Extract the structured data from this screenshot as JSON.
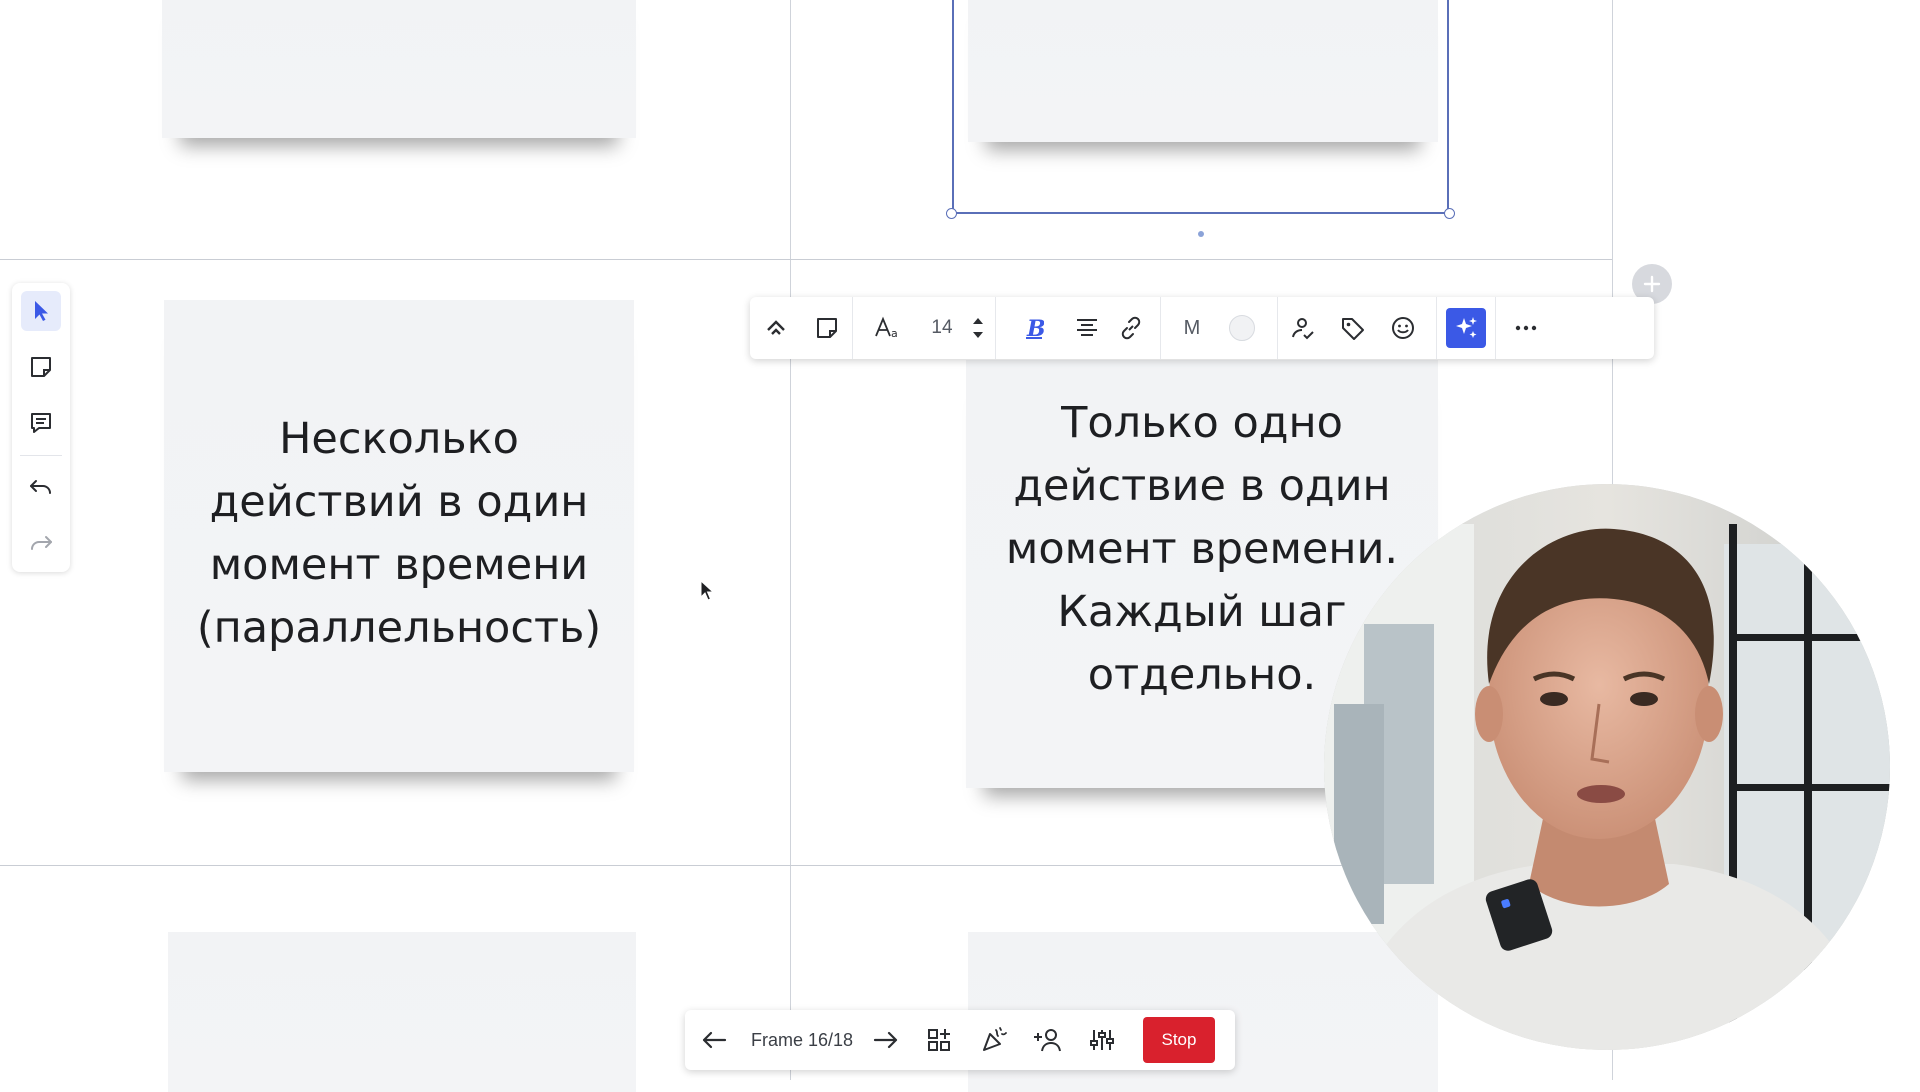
{
  "sticky_notes": {
    "left_text": "Несколько\nдействий в один\nмомент времени\n(параллельность)",
    "right_text": "Только одно\nдействие в один\nмомент времени.\nКаждый шаг\nотдельно."
  },
  "context_toolbar": {
    "font_size": "14",
    "font_size_letter": "M",
    "icons": [
      "convert-icon",
      "sticky-note-icon",
      "text-style-icon",
      "font-size-stepper",
      "bold-icon",
      "align-center-icon",
      "link-icon",
      "font-letter",
      "color-swatch",
      "assign-icon",
      "tag-icon",
      "emoji-icon",
      "ai-sparkle-icon",
      "more-icon"
    ]
  },
  "tool_rail": {
    "items": [
      "select-tool",
      "sticky-note-tool",
      "comment-tool",
      "undo",
      "redo"
    ]
  },
  "presentation_bar": {
    "frame_label": "Frame 16/18",
    "stop_label": "Stop"
  },
  "colors": {
    "accent": "#3b59e6",
    "stop": "#d9212d",
    "selection": "#5a6fb8",
    "sticky": "#f2f3f5"
  }
}
